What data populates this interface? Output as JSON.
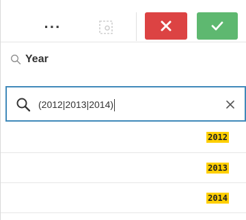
{
  "toolbar": {
    "more_label": "···",
    "more_icon": "more-options-icon",
    "select_icon": "selection-tool-icon",
    "cancel_icon": "close-icon",
    "confirm_icon": "check-icon",
    "cancel_color": "#dc4343",
    "confirm_color": "#5eb870"
  },
  "field": {
    "title": "Year",
    "icon": "search-icon"
  },
  "search": {
    "value": "(2012|2013|2014)",
    "icon": "search-icon",
    "clear_icon": "clear-icon",
    "border_color": "#3e88b9"
  },
  "list": {
    "highlight_color": "#ffcf01",
    "items": [
      {
        "value": "2012"
      },
      {
        "value": "2013"
      },
      {
        "value": "2014"
      }
    ]
  }
}
